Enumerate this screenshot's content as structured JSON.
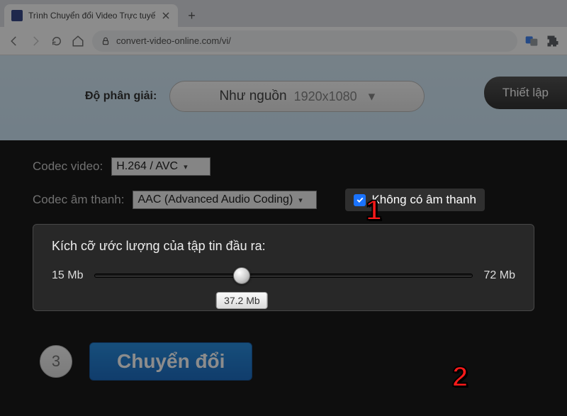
{
  "browser": {
    "tab_title": "Trình Chuyển đổi Video Trực tuyế",
    "url": "convert-video-online.com/vi/"
  },
  "resolution": {
    "label": "Độ phân giải:",
    "value_text": "Như nguồn",
    "dimensions": "1920x1080"
  },
  "settings_button": "Thiết lập",
  "codec_video": {
    "label": "Codec video:",
    "value": "H.264 / AVC"
  },
  "codec_audio": {
    "label": "Codec âm thanh:",
    "value": "AAC (Advanced Audio Coding)"
  },
  "no_audio": {
    "checked": true,
    "label": "Không có âm thanh"
  },
  "size_panel": {
    "title": "Kích cỡ ước lượng của tập tin đầu ra:",
    "min": "15 Mb",
    "max": "72 Mb",
    "value": "37.2 Mb"
  },
  "step_number": "3",
  "convert_button": "Chuyển đổi",
  "annotations": {
    "one": "1",
    "two": "2"
  }
}
